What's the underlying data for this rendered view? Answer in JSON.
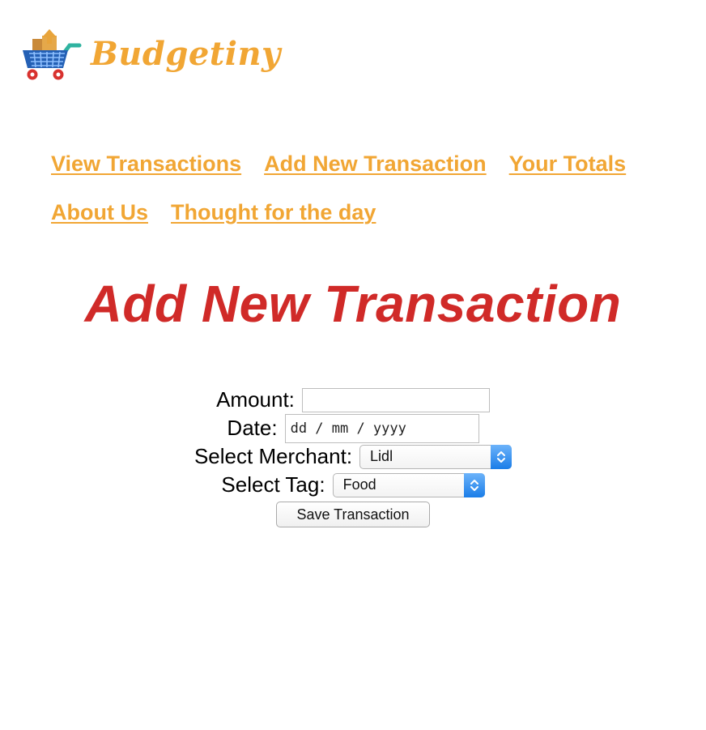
{
  "brand": {
    "name": "Budgetiny",
    "logo_icon": "shopping-cart-icon",
    "color": "#f1a634"
  },
  "nav": {
    "row1": [
      "View Transactions",
      "Add New Transaction",
      "Your Totals"
    ],
    "row2": [
      "About Us",
      "Thought for the day"
    ],
    "color": "#f1a634"
  },
  "page": {
    "title": "Add New Transaction",
    "title_color": "#d02a28"
  },
  "form": {
    "amount": {
      "label": "Amount:",
      "value": ""
    },
    "date": {
      "label": "Date:",
      "placeholder": "dd / mm / yyyy"
    },
    "merchant": {
      "label": "Select Merchant:",
      "selected": "Lidl"
    },
    "tag": {
      "label": "Select Tag:",
      "selected": "Food"
    },
    "submit_label": "Save Transaction"
  }
}
